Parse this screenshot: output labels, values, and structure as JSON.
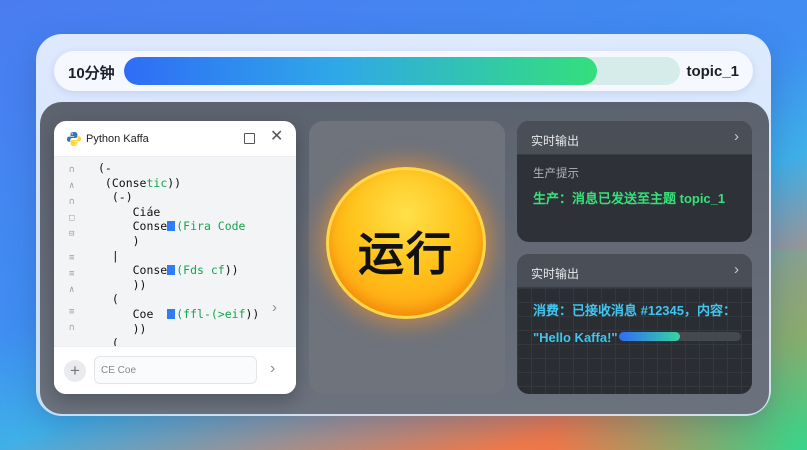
{
  "header": {
    "timer_label": "10分钟",
    "progress": 0.85,
    "topic_label": "topic_1"
  },
  "editor": {
    "title": "Python Kaffa",
    "gutter_marks": [
      "∩",
      "∧",
      "∩",
      "□",
      "⊟",
      "≡",
      "≡",
      "∧",
      "≡",
      "∩"
    ],
    "code_lines": [
      {
        "pre": "(-",
        "sq": "",
        "green": "",
        "post": ""
      },
      {
        "pre": " (Conse",
        "sq": "",
        "green": "tic",
        "post": "))"
      },
      {
        "pre": "  (-)",
        "sq": "",
        "green": "",
        "post": ""
      },
      {
        "pre": "     Ciáe",
        "sq": "",
        "green": "",
        "post": ""
      },
      {
        "pre": "     Conse",
        "sq": "■",
        "green": "(Fira Code",
        "post": ""
      },
      {
        "pre": "     )",
        "sq": "",
        "green": "",
        "post": ""
      },
      {
        "pre": "  |",
        "sq": "",
        "green": "",
        "post": ""
      },
      {
        "pre": "     Conse",
        "sq": "■",
        "green": "(Fds cf",
        "post": "))"
      },
      {
        "pre": "     ))",
        "sq": "",
        "green": "",
        "post": ""
      },
      {
        "pre": "  (",
        "sq": "",
        "green": "",
        "post": ""
      },
      {
        "pre": "     Coe  ",
        "sq": "■",
        "green": "(ffl-(>eif",
        "post": "))"
      },
      {
        "pre": "     ))",
        "sq": "",
        "green": "",
        "post": ""
      },
      {
        "pre": "  (",
        "sq": "",
        "green": "",
        "post": ""
      }
    ],
    "input_placeholder": "CE   Coe"
  },
  "run_button": {
    "label": "运行"
  },
  "producer_output": {
    "title": "实时输出",
    "subtitle": "生产提示",
    "message": "生产：消息已发送至主题 topic_1"
  },
  "consumer_output": {
    "title": "实时输出",
    "message_line1": "消费：已接收消息 #12345，内容：",
    "message_line2": "\"Hello Kaffa!\"",
    "progress": 0.5
  },
  "colors": {
    "accent_green": "#35e27a",
    "accent_cyan": "#3ec6f0",
    "run_orange": "#ffb01a"
  }
}
